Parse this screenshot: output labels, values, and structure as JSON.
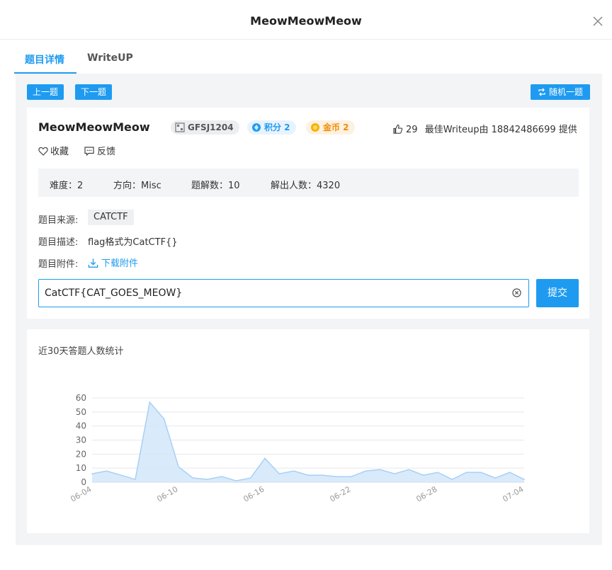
{
  "modal": {
    "title": "MeowMeowMeow"
  },
  "tabs": [
    {
      "label": "题目详情"
    },
    {
      "label": "WriteUP"
    }
  ],
  "nav": {
    "prev_label": "上一题",
    "next_label": "下一题",
    "random_label": "随机一题"
  },
  "challenge": {
    "title": "MeowMeowMeow",
    "id_badge": "GFSJ1204",
    "points_badge": "积分 2",
    "coins_badge": "金币 2",
    "likes": "29",
    "writeup_credit": "最佳Writeup由 18842486699 提供",
    "favorite_label": "收藏",
    "feedback_label": "反馈",
    "stats": {
      "difficulty": "难度：2",
      "direction": "方向：Misc",
      "solve_count": "题解数：10",
      "solvers": "解出人数：4320"
    },
    "source_label": "题目来源:",
    "source_value": "CATCTF",
    "desc_label": "题目描述:",
    "desc_value": "flag格式为CatCTF{}",
    "attach_label": "题目附件:",
    "attach_link": "下载附件",
    "flag_value": "CatCTF{CAT_GOES_MEOW}",
    "submit_label": "提交"
  },
  "colors": {
    "accent": "#1e9bf0",
    "panel_bg": "#f2f4f6",
    "points": "#1e9bf0",
    "coins": "#f08c00"
  },
  "chart_title": "近30天答题人数统计",
  "chart_data": {
    "type": "area",
    "x": [
      "06-04",
      "06-05",
      "06-06",
      "06-07",
      "06-08",
      "06-09",
      "06-10",
      "06-11",
      "06-12",
      "06-13",
      "06-14",
      "06-15",
      "06-16",
      "06-17",
      "06-18",
      "06-19",
      "06-20",
      "06-21",
      "06-22",
      "06-23",
      "06-24",
      "06-25",
      "06-26",
      "06-27",
      "06-28",
      "06-29",
      "06-30",
      "07-01",
      "07-02",
      "07-03",
      "07-04"
    ],
    "x_tick_labels": [
      "06-04",
      "06-10",
      "06-16",
      "06-22",
      "06-28",
      "07-04"
    ],
    "y_ticks": [
      0,
      10,
      20,
      30,
      40,
      50,
      60
    ],
    "values": [
      6,
      8,
      5,
      2,
      57,
      45,
      11,
      3,
      2,
      4,
      1,
      3,
      17,
      6,
      8,
      5,
      5,
      4,
      4,
      8,
      9,
      6,
      9,
      5,
      7,
      2,
      7,
      7,
      3,
      7,
      2
    ],
    "ylim": [
      0,
      60
    ],
    "grid": true,
    "color": "#a8d0f5"
  }
}
